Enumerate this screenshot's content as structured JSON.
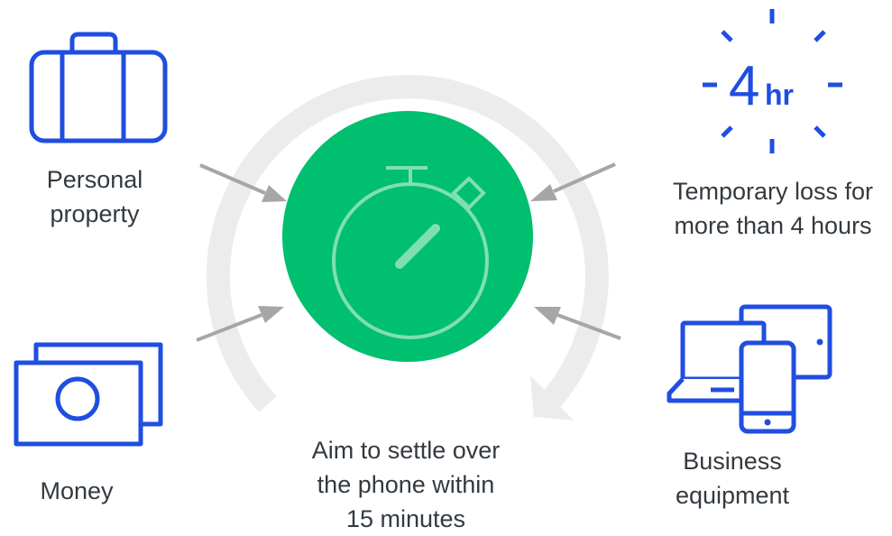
{
  "colors": {
    "icon_blue": "#1f4ee0",
    "circle_green": "#00bf6f",
    "ring_gray": "#ececec",
    "arrow_gray": "#a6a6a6",
    "text": "#333a40"
  },
  "items": {
    "personal_property": {
      "icon": "suitcase-icon",
      "line1": "Personal",
      "line2": "property"
    },
    "money": {
      "icon": "banknote-icon",
      "line1": "Money"
    },
    "temporary_loss": {
      "icon": "four-hour-clock-icon",
      "badge_number": "4",
      "badge_unit": "hr",
      "line1": "Temporary loss for",
      "line2": "more than 4 hours"
    },
    "business_equipment": {
      "icon": "devices-icon",
      "line1": "Business",
      "line2": "equipment"
    }
  },
  "center": {
    "icon": "stopwatch-icon",
    "line1": "Aim to settle over",
    "line2": "the phone within",
    "line3": "15 minutes"
  }
}
